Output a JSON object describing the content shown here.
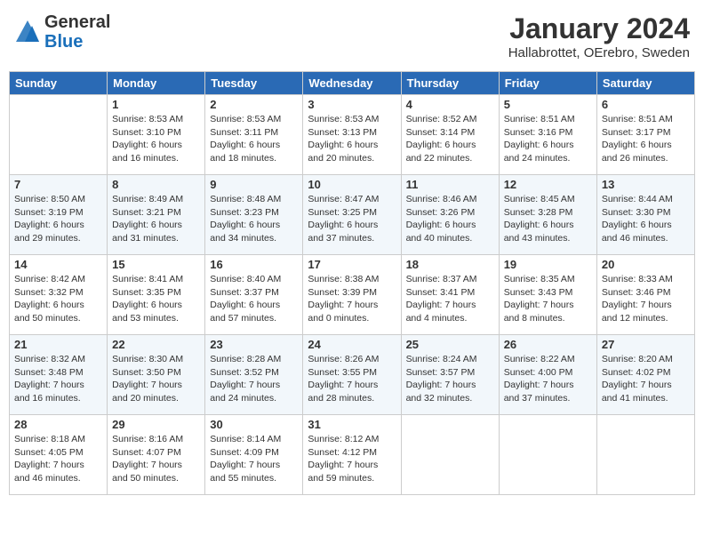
{
  "header": {
    "logo_line1": "General",
    "logo_line2": "Blue",
    "month": "January 2024",
    "location": "Hallabrottet, OErebro, Sweden"
  },
  "weekdays": [
    "Sunday",
    "Monday",
    "Tuesday",
    "Wednesday",
    "Thursday",
    "Friday",
    "Saturday"
  ],
  "weeks": [
    [
      {
        "day": "",
        "info": ""
      },
      {
        "day": "1",
        "info": "Sunrise: 8:53 AM\nSunset: 3:10 PM\nDaylight: 6 hours\nand 16 minutes."
      },
      {
        "day": "2",
        "info": "Sunrise: 8:53 AM\nSunset: 3:11 PM\nDaylight: 6 hours\nand 18 minutes."
      },
      {
        "day": "3",
        "info": "Sunrise: 8:53 AM\nSunset: 3:13 PM\nDaylight: 6 hours\nand 20 minutes."
      },
      {
        "day": "4",
        "info": "Sunrise: 8:52 AM\nSunset: 3:14 PM\nDaylight: 6 hours\nand 22 minutes."
      },
      {
        "day": "5",
        "info": "Sunrise: 8:51 AM\nSunset: 3:16 PM\nDaylight: 6 hours\nand 24 minutes."
      },
      {
        "day": "6",
        "info": "Sunrise: 8:51 AM\nSunset: 3:17 PM\nDaylight: 6 hours\nand 26 minutes."
      }
    ],
    [
      {
        "day": "7",
        "info": "Sunrise: 8:50 AM\nSunset: 3:19 PM\nDaylight: 6 hours\nand 29 minutes."
      },
      {
        "day": "8",
        "info": "Sunrise: 8:49 AM\nSunset: 3:21 PM\nDaylight: 6 hours\nand 31 minutes."
      },
      {
        "day": "9",
        "info": "Sunrise: 8:48 AM\nSunset: 3:23 PM\nDaylight: 6 hours\nand 34 minutes."
      },
      {
        "day": "10",
        "info": "Sunrise: 8:47 AM\nSunset: 3:25 PM\nDaylight: 6 hours\nand 37 minutes."
      },
      {
        "day": "11",
        "info": "Sunrise: 8:46 AM\nSunset: 3:26 PM\nDaylight: 6 hours\nand 40 minutes."
      },
      {
        "day": "12",
        "info": "Sunrise: 8:45 AM\nSunset: 3:28 PM\nDaylight: 6 hours\nand 43 minutes."
      },
      {
        "day": "13",
        "info": "Sunrise: 8:44 AM\nSunset: 3:30 PM\nDaylight: 6 hours\nand 46 minutes."
      }
    ],
    [
      {
        "day": "14",
        "info": "Sunrise: 8:42 AM\nSunset: 3:32 PM\nDaylight: 6 hours\nand 50 minutes."
      },
      {
        "day": "15",
        "info": "Sunrise: 8:41 AM\nSunset: 3:35 PM\nDaylight: 6 hours\nand 53 minutes."
      },
      {
        "day": "16",
        "info": "Sunrise: 8:40 AM\nSunset: 3:37 PM\nDaylight: 6 hours\nand 57 minutes."
      },
      {
        "day": "17",
        "info": "Sunrise: 8:38 AM\nSunset: 3:39 PM\nDaylight: 7 hours\nand 0 minutes."
      },
      {
        "day": "18",
        "info": "Sunrise: 8:37 AM\nSunset: 3:41 PM\nDaylight: 7 hours\nand 4 minutes."
      },
      {
        "day": "19",
        "info": "Sunrise: 8:35 AM\nSunset: 3:43 PM\nDaylight: 7 hours\nand 8 minutes."
      },
      {
        "day": "20",
        "info": "Sunrise: 8:33 AM\nSunset: 3:46 PM\nDaylight: 7 hours\nand 12 minutes."
      }
    ],
    [
      {
        "day": "21",
        "info": "Sunrise: 8:32 AM\nSunset: 3:48 PM\nDaylight: 7 hours\nand 16 minutes."
      },
      {
        "day": "22",
        "info": "Sunrise: 8:30 AM\nSunset: 3:50 PM\nDaylight: 7 hours\nand 20 minutes."
      },
      {
        "day": "23",
        "info": "Sunrise: 8:28 AM\nSunset: 3:52 PM\nDaylight: 7 hours\nand 24 minutes."
      },
      {
        "day": "24",
        "info": "Sunrise: 8:26 AM\nSunset: 3:55 PM\nDaylight: 7 hours\nand 28 minutes."
      },
      {
        "day": "25",
        "info": "Sunrise: 8:24 AM\nSunset: 3:57 PM\nDaylight: 7 hours\nand 32 minutes."
      },
      {
        "day": "26",
        "info": "Sunrise: 8:22 AM\nSunset: 4:00 PM\nDaylight: 7 hours\nand 37 minutes."
      },
      {
        "day": "27",
        "info": "Sunrise: 8:20 AM\nSunset: 4:02 PM\nDaylight: 7 hours\nand 41 minutes."
      }
    ],
    [
      {
        "day": "28",
        "info": "Sunrise: 8:18 AM\nSunset: 4:05 PM\nDaylight: 7 hours\nand 46 minutes."
      },
      {
        "day": "29",
        "info": "Sunrise: 8:16 AM\nSunset: 4:07 PM\nDaylight: 7 hours\nand 50 minutes."
      },
      {
        "day": "30",
        "info": "Sunrise: 8:14 AM\nSunset: 4:09 PM\nDaylight: 7 hours\nand 55 minutes."
      },
      {
        "day": "31",
        "info": "Sunrise: 8:12 AM\nSunset: 4:12 PM\nDaylight: 7 hours\nand 59 minutes."
      },
      {
        "day": "",
        "info": ""
      },
      {
        "day": "",
        "info": ""
      },
      {
        "day": "",
        "info": ""
      }
    ]
  ]
}
